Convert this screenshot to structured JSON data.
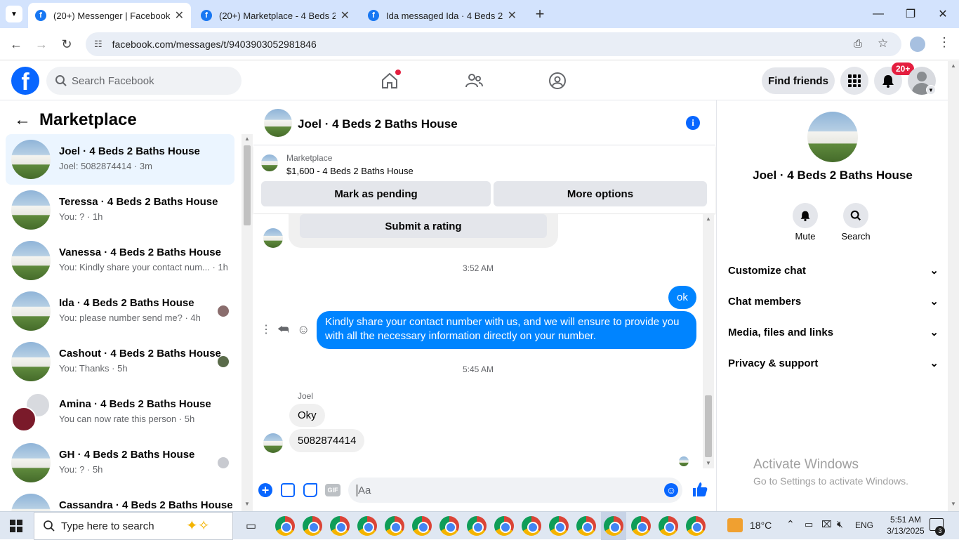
{
  "browser": {
    "tabs": [
      {
        "title": "(20+) Messenger | Facebook"
      },
      {
        "title": "(20+) Marketplace - 4 Beds 2 Ba"
      },
      {
        "title": "Ida messaged Ida · 4 Beds 2 Bat"
      }
    ],
    "url": "facebook.com/messages/t/9403903052981846"
  },
  "fb_header": {
    "search_placeholder": "Search Facebook",
    "find_friends": "Find friends",
    "notification_badge": "20+"
  },
  "left_panel": {
    "title": "Marketplace",
    "conversations": [
      {
        "name": "Joel · 4 Beds 2 Baths House",
        "preview": "Joel: 5082874414 · 3m",
        "selected": true
      },
      {
        "name": "Teressa · 4 Beds 2 Baths House",
        "preview": "You: ? · 1h"
      },
      {
        "name": "Vanessa · 4 Beds 2 Baths House",
        "preview": "You: Kindly share your contact num... · 1h"
      },
      {
        "name": "Ida · 4 Beds 2 Baths House",
        "preview": "You: please number send me? · 4h"
      },
      {
        "name": "Cashout · 4 Beds 2 Baths House",
        "preview": "You: Thanks · 5h"
      },
      {
        "name": "Amina · 4 Beds 2 Baths House",
        "preview": "You can now rate this person · 5h"
      },
      {
        "name": "GH · 4 Beds 2 Baths House",
        "preview": "You: ? · 5h"
      },
      {
        "name": "Cassandra · 4 Beds 2 Baths House",
        "preview": ""
      }
    ]
  },
  "chat": {
    "header_title": "Joel · 4 Beds 2 Baths House",
    "listing_label": "Marketplace",
    "listing_price": "$1,600 - 4 Beds 2 Baths House",
    "mark_pending": "Mark as pending",
    "more_options": "More options",
    "submit_rating": "Submit a rating",
    "ts1": "3:52 AM",
    "msg_ok": "ok",
    "msg_share_line1": "Kindly share your contact number with us, and we will ensure to provide you",
    "msg_share_line2": "with all the necessary information directly on your number.",
    "ts2": "5:45 AM",
    "sender": "Joel",
    "msg_oky": "Oky",
    "msg_number": "5082874414",
    "input_placeholder": "Aa"
  },
  "right_panel": {
    "name": "Joel · 4 Beds 2 Baths House",
    "mute": "Mute",
    "search": "Search",
    "items": [
      "Customize chat",
      "Chat members",
      "Media, files and links",
      "Privacy & support"
    ],
    "activate_title": "Activate Windows",
    "activate_sub": "Go to Settings to activate Windows."
  },
  "taskbar": {
    "search_placeholder": "Type here to search",
    "weather": "18°C",
    "lang": "ENG",
    "time": "5:51 AM",
    "date": "3/13/2025",
    "notif_count": "3"
  },
  "colors": {
    "fb_blue": "#0866ff",
    "bubble_blue": "#0084ff",
    "badge_red": "#e41e3f"
  }
}
